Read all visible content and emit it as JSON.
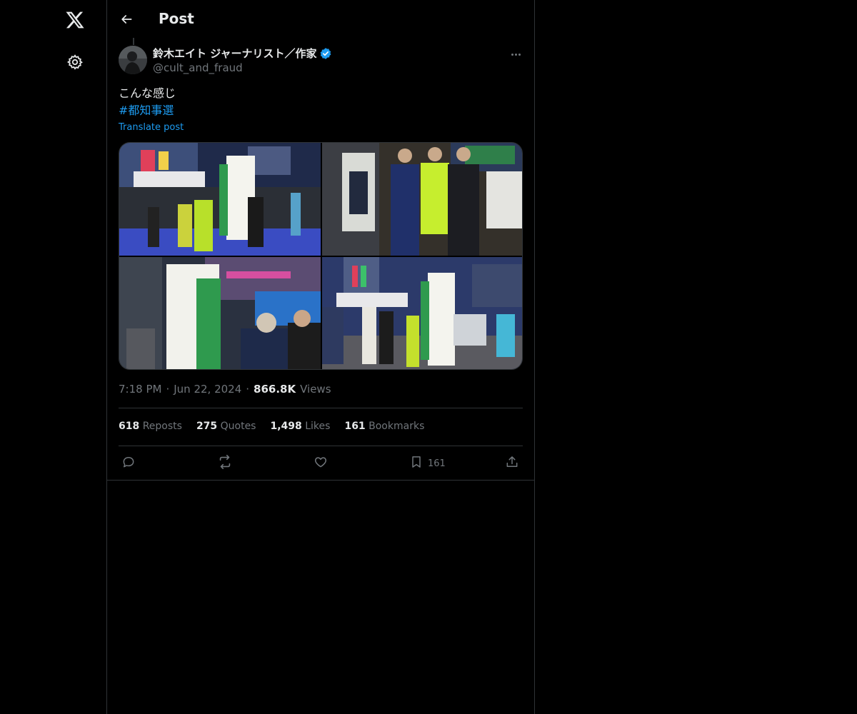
{
  "nav": {
    "logo_icon": "x-logo-icon",
    "settings_icon": "gear-icon"
  },
  "header": {
    "title": "Post",
    "back_icon": "arrow-left-icon"
  },
  "post": {
    "author_name": "鈴木エイト ジャーナリスト／作家",
    "author_handle": "@cult_and_fraud",
    "verified": true,
    "text": "こんな感じ",
    "hashtag": "#都知事選",
    "translate_label": "Translate post",
    "time": "7:18 PM",
    "date": "Jun 22, 2024",
    "views_count": "866.8K",
    "views_label": "Views",
    "stats": [
      {
        "count": "618",
        "label": "Reposts"
      },
      {
        "count": "275",
        "label": "Quotes"
      },
      {
        "count": "1,498",
        "label": "Likes"
      },
      {
        "count": "161",
        "label": "Bookmarks"
      }
    ],
    "actions": {
      "reply_icon": "reply-icon",
      "repost_icon": "repost-icon",
      "like_icon": "heart-icon",
      "bookmark_icon": "bookmark-icon",
      "bookmark_count": "161",
      "share_icon": "share-icon"
    }
  },
  "colors": {
    "accent": "#1d9bf0",
    "background": "#000000",
    "border": "#2f3336",
    "muted": "#71767b"
  }
}
